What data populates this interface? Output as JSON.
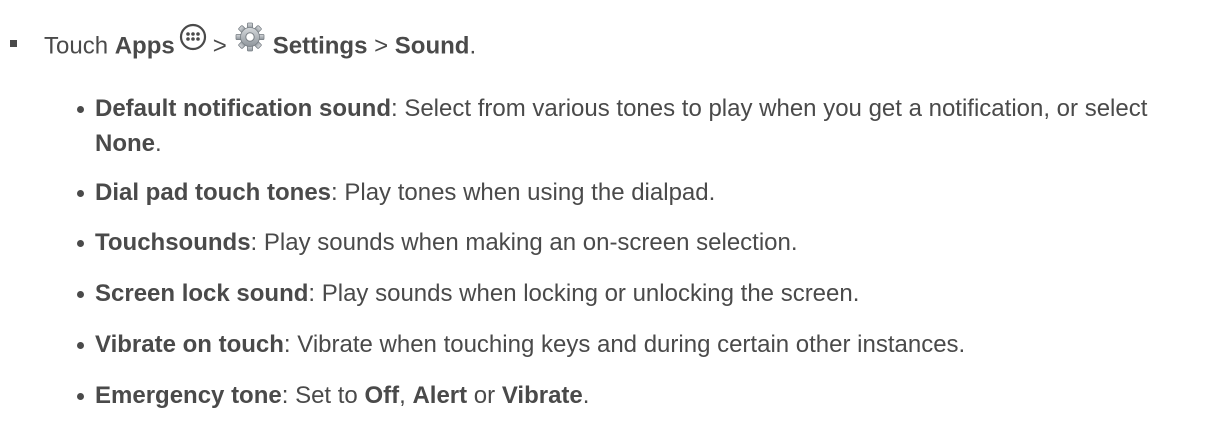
{
  "intro": {
    "touch": "Touch",
    "apps": "Apps",
    "sep1": ">",
    "settings": "Settings",
    "sep2": ">",
    "sound": "Sound",
    "period": "."
  },
  "items": [
    {
      "term": "Default notification sound",
      "colon": ":",
      "desc": " Select from various tones to play when you get a notification, or select ",
      "extra": "None",
      "end": "."
    },
    {
      "term": "Dial pad touch tones",
      "colon": ":",
      "desc": " Play tones when using the dialpad."
    },
    {
      "term": "Touchsounds",
      "colon": ":",
      "desc": " Play sounds when making an on-screen selection."
    },
    {
      "term": "Screen lock sound",
      "colon": ":",
      "desc": " Play sounds when locking or unlocking the screen."
    },
    {
      "term": "Vibrate on touch",
      "colon": ":",
      "desc": " Vibrate when touching keys and during certain other instances."
    },
    {
      "term": "Emergency tone",
      "colon": ":",
      "desc": " Set to ",
      "opt1": "Off",
      "comma": ", ",
      "opt2": "Alert",
      "or": " or ",
      "opt3": "Vibrate",
      "end": "."
    }
  ],
  "icons": {
    "apps": "apps-grid-icon",
    "settings": "gear-icon"
  }
}
